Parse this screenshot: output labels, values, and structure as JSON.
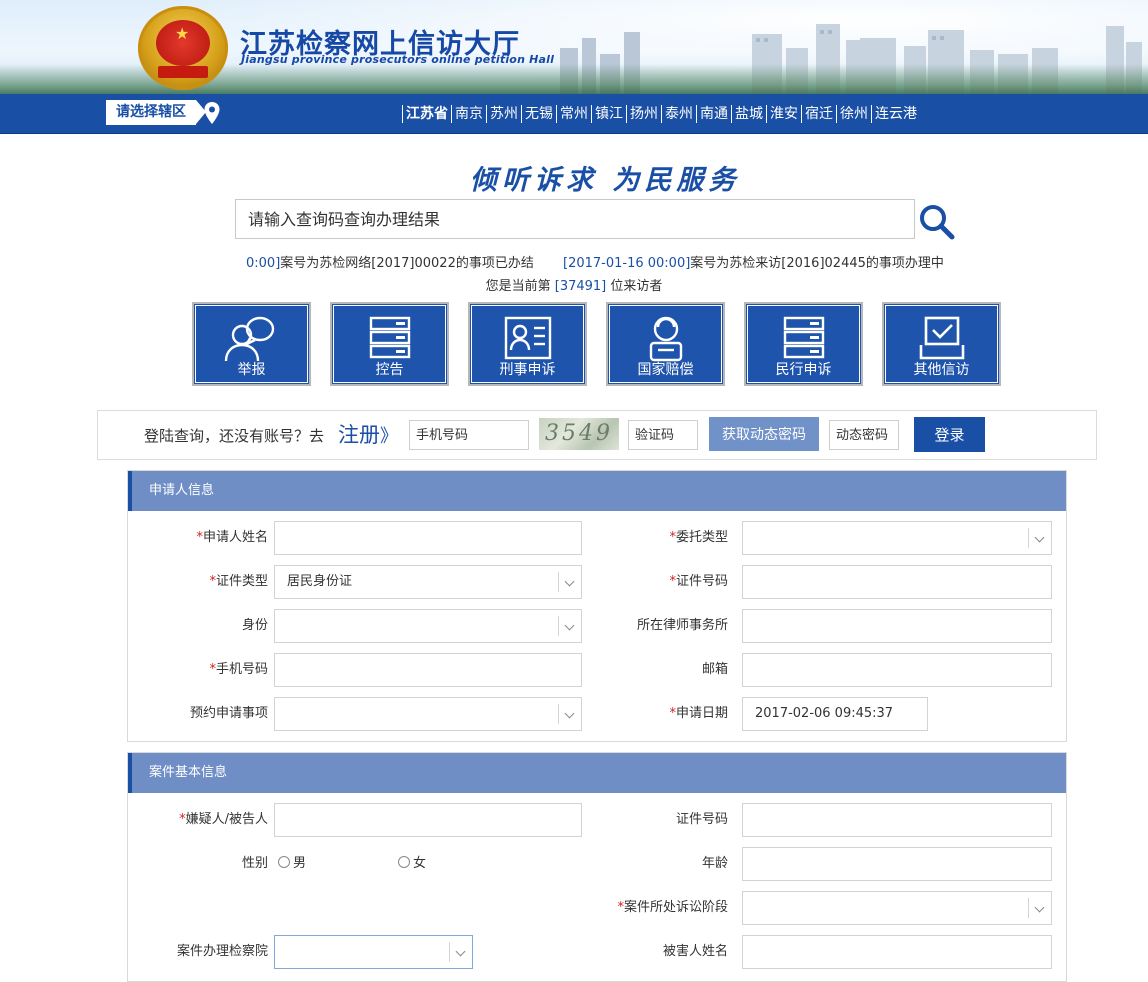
{
  "header": {
    "title": "江苏检察网上信访大厅",
    "subtitle": "Jiangsu province prosecutors online petition Hall"
  },
  "region": {
    "select_label": "请选择辖区",
    "cities": [
      "江苏省",
      "南京",
      "苏州",
      "无锡",
      "常州",
      "镇江",
      "扬州",
      "泰州",
      "南通",
      "盐城",
      "淮安",
      "宿迁",
      "徐州",
      "连云港"
    ]
  },
  "slogan": "倾听诉求 为民服务",
  "search": {
    "placeholder": "请输入查询码查询办理结果"
  },
  "ticker": [
    {
      "date": "0:00]",
      "text": "案号为苏检网络[2017]00022的事项已办结"
    },
    {
      "date": "[2017-01-16 00:00]",
      "text": "案号为苏检来访[2016]02445的事项办理中"
    }
  ],
  "visitors": {
    "prefix": "您是当前第",
    "count": "[37491]",
    "suffix": "位来访者"
  },
  "tiles": [
    {
      "label": "举报",
      "icon": "people-icon"
    },
    {
      "label": "控告",
      "icon": "server-icon"
    },
    {
      "label": "刑事申诉",
      "icon": "id-card-icon"
    },
    {
      "label": "国家赔偿",
      "icon": "person-icon"
    },
    {
      "label": "民行申诉",
      "icon": "server-icon"
    },
    {
      "label": "其他信访",
      "icon": "checkbox-icon"
    }
  ],
  "login": {
    "prompt": "登陆查询，还没有账号？去",
    "register": "注册",
    "register_arrow": "》",
    "phone_placeholder": "手机号码",
    "captcha": "3549",
    "vcode_placeholder": "验证码",
    "dynamic_button": "获取动态密码",
    "dcode_placeholder": "动态密码",
    "login_button": "登录"
  },
  "applicant": {
    "section_title": "申请人信息",
    "name": "申请人姓名",
    "entrust_type": "委托类型",
    "cert_type": "证件类型",
    "cert_type_value": "居民身份证",
    "cert_no": "证件号码",
    "identity": "身份",
    "law_firm": "所在律师事务所",
    "phone": "手机号码",
    "email": "邮箱",
    "appointment": "预约申请事项",
    "apply_date": "申请日期",
    "apply_date_value": "2017-02-06 09:45:37"
  },
  "case": {
    "section_title": "案件基本信息",
    "suspect": "嫌疑人/被告人",
    "cert_no": "证件号码",
    "gender": "性别",
    "male": "男",
    "female": "女",
    "age": "年龄",
    "stage": "案件所处诉讼阶段",
    "procuratorate": "案件办理检察院",
    "victim": "被害人姓名"
  },
  "colors": {
    "brand_blue": "#1a4fa6",
    "section_header": "#6f8ec6",
    "required_mark": "#d21f1f"
  }
}
